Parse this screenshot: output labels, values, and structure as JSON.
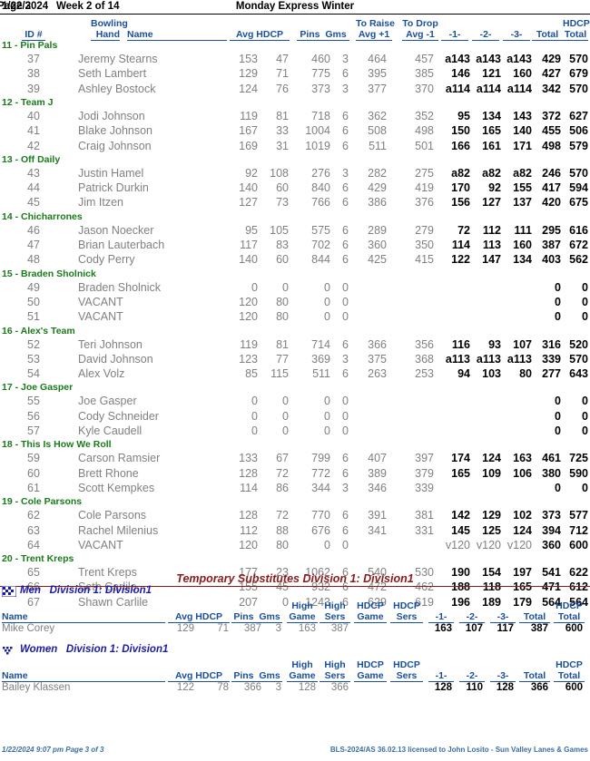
{
  "header": {
    "date": "1/22/2024",
    "week": "Week 2 of 14",
    "league": "Monday Express Winter",
    "page": "Page 3"
  },
  "columns": {
    "id": "ID #",
    "bowling": "Bowling",
    "hand": "Hand",
    "name": "Name",
    "avg_hdcp": "Avg HDCP",
    "pins_gms": "Pins  Gms",
    "to_raise": "To Raise",
    "raise_avg": "Avg +1",
    "to_drop": "To Drop",
    "drop_avg": "Avg -1",
    "g1": "-1-",
    "g2": "-2-",
    "g3": "-3-",
    "total": "Total",
    "hdcp": "HDCP",
    "hdcp_total": "Total"
  },
  "teams": [
    {
      "label": "11 - Pin Pals",
      "bowlers": [
        {
          "id": "37",
          "name": "Jeremy Stearns",
          "avg": "153",
          "hdcp": "47",
          "pins": "460",
          "gms": "3",
          "raise": "464",
          "drop": "457",
          "g1": "a143",
          "g2": "a143",
          "g3": "a143",
          "total": "429",
          "hdcp_total": "570",
          "bold_games": true
        },
        {
          "id": "38",
          "name": "Seth Lambert",
          "avg": "129",
          "hdcp": "71",
          "pins": "775",
          "gms": "6",
          "raise": "395",
          "drop": "385",
          "g1": "146",
          "g2": "121",
          "g3": "160",
          "total": "427",
          "hdcp_total": "679",
          "bold_games": true
        },
        {
          "id": "39",
          "name": "Ashley Bostock",
          "avg": "124",
          "hdcp": "76",
          "pins": "373",
          "gms": "3",
          "raise": "377",
          "drop": "370",
          "g1": "a114",
          "g2": "a114",
          "g3": "a114",
          "total": "342",
          "hdcp_total": "570",
          "bold_games": true
        }
      ]
    },
    {
      "label": "12 - Team J",
      "bowlers": [
        {
          "id": "40",
          "name": "Jodi Johnson",
          "avg": "119",
          "hdcp": "81",
          "pins": "718",
          "gms": "6",
          "raise": "362",
          "drop": "352",
          "g1": "95",
          "g2": "134",
          "g3": "143",
          "total": "372",
          "hdcp_total": "627",
          "bold_games": true
        },
        {
          "id": "41",
          "name": "Blake Johnson",
          "avg": "167",
          "hdcp": "33",
          "pins": "1004",
          "gms": "6",
          "raise": "508",
          "drop": "498",
          "g1": "150",
          "g2": "165",
          "g3": "140",
          "total": "455",
          "hdcp_total": "506",
          "bold_games": true
        },
        {
          "id": "42",
          "name": "Craig Johnson",
          "avg": "169",
          "hdcp": "31",
          "pins": "1019",
          "gms": "6",
          "raise": "511",
          "drop": "501",
          "g1": "166",
          "g2": "161",
          "g3": "171",
          "total": "498",
          "hdcp_total": "579",
          "bold_games": true
        }
      ]
    },
    {
      "label": "13 - Off Daily",
      "bowlers": [
        {
          "id": "43",
          "name": "Justin Hamel",
          "avg": "92",
          "hdcp": "108",
          "pins": "276",
          "gms": "3",
          "raise": "282",
          "drop": "275",
          "g1": "a82",
          "g2": "a82",
          "g3": "a82",
          "total": "246",
          "hdcp_total": "570",
          "bold_games": true
        },
        {
          "id": "44",
          "name": "Patrick Durkin",
          "avg": "140",
          "hdcp": "60",
          "pins": "840",
          "gms": "6",
          "raise": "429",
          "drop": "419",
          "g1": "170",
          "g2": "92",
          "g3": "155",
          "total": "417",
          "hdcp_total": "594",
          "bold_games": true
        },
        {
          "id": "45",
          "name": "Jim Itzen",
          "avg": "127",
          "hdcp": "73",
          "pins": "766",
          "gms": "6",
          "raise": "386",
          "drop": "376",
          "g1": "156",
          "g2": "127",
          "g3": "137",
          "total": "420",
          "hdcp_total": "675",
          "bold_games": true
        }
      ]
    },
    {
      "label": "14 - Chicharrones",
      "bowlers": [
        {
          "id": "46",
          "name": "Jason Noecker",
          "avg": "95",
          "hdcp": "105",
          "pins": "575",
          "gms": "6",
          "raise": "289",
          "drop": "279",
          "g1": "72",
          "g2": "112",
          "g3": "111",
          "total": "295",
          "hdcp_total": "616",
          "bold_games": true
        },
        {
          "id": "47",
          "name": "Brian Lauterbach",
          "avg": "117",
          "hdcp": "83",
          "pins": "702",
          "gms": "6",
          "raise": "360",
          "drop": "350",
          "g1": "114",
          "g2": "113",
          "g3": "160",
          "total": "387",
          "hdcp_total": "672",
          "bold_games": true
        },
        {
          "id": "48",
          "name": "Cody Perry",
          "avg": "140",
          "hdcp": "60",
          "pins": "844",
          "gms": "6",
          "raise": "425",
          "drop": "415",
          "g1": "122",
          "g2": "147",
          "g3": "134",
          "total": "403",
          "hdcp_total": "562",
          "bold_games": true
        }
      ]
    },
    {
      "label": "15 - Braden Sholnick",
      "bowlers": [
        {
          "id": "49",
          "name": "Braden Sholnick",
          "avg": "0",
          "hdcp": "0",
          "pins": "0",
          "gms": "0",
          "raise": "",
          "drop": "",
          "g1": "",
          "g2": "",
          "g3": "",
          "total": "0",
          "hdcp_total": "0",
          "bold_games": false
        },
        {
          "id": "50",
          "name": "VACANT",
          "avg": "120",
          "hdcp": "80",
          "pins": "0",
          "gms": "0",
          "raise": "",
          "drop": "",
          "g1": "",
          "g2": "",
          "g3": "",
          "total": "0",
          "hdcp_total": "0",
          "bold_games": false
        },
        {
          "id": "51",
          "name": "VACANT",
          "avg": "120",
          "hdcp": "80",
          "pins": "0",
          "gms": "0",
          "raise": "",
          "drop": "",
          "g1": "",
          "g2": "",
          "g3": "",
          "total": "0",
          "hdcp_total": "0",
          "bold_games": false
        }
      ]
    },
    {
      "label": "16 - Alex's Team",
      "bowlers": [
        {
          "id": "52",
          "name": "Teri Johnson",
          "avg": "119",
          "hdcp": "81",
          "pins": "714",
          "gms": "6",
          "raise": "366",
          "drop": "356",
          "g1": "116",
          "g2": "93",
          "g3": "107",
          "total": "316",
          "hdcp_total": "520",
          "bold_games": true
        },
        {
          "id": "53",
          "name": "David Johnson",
          "avg": "123",
          "hdcp": "77",
          "pins": "369",
          "gms": "3",
          "raise": "375",
          "drop": "368",
          "g1": "a113",
          "g2": "a113",
          "g3": "a113",
          "total": "339",
          "hdcp_total": "570",
          "bold_games": true
        },
        {
          "id": "54",
          "name": "Alex Volz",
          "avg": "85",
          "hdcp": "115",
          "pins": "511",
          "gms": "6",
          "raise": "263",
          "drop": "253",
          "g1": "94",
          "g2": "103",
          "g3": "80",
          "total": "277",
          "hdcp_total": "643",
          "bold_games": true
        }
      ]
    },
    {
      "label": "17 - Joe Gasper",
      "bowlers": [
        {
          "id": "55",
          "name": "Joe Gasper",
          "avg": "0",
          "hdcp": "0",
          "pins": "0",
          "gms": "0",
          "raise": "",
          "drop": "",
          "g1": "",
          "g2": "",
          "g3": "",
          "total": "0",
          "hdcp_total": "0",
          "bold_games": false
        },
        {
          "id": "56",
          "name": "Cody Schneider",
          "avg": "0",
          "hdcp": "0",
          "pins": "0",
          "gms": "0",
          "raise": "",
          "drop": "",
          "g1": "",
          "g2": "",
          "g3": "",
          "total": "0",
          "hdcp_total": "0",
          "bold_games": false
        },
        {
          "id": "57",
          "name": "Kyle Caudell",
          "avg": "0",
          "hdcp": "0",
          "pins": "0",
          "gms": "0",
          "raise": "",
          "drop": "",
          "g1": "",
          "g2": "",
          "g3": "",
          "total": "0",
          "hdcp_total": "0",
          "bold_games": false
        }
      ]
    },
    {
      "label": "18 - This Is How We Roll",
      "bowlers": [
        {
          "id": "59",
          "name": "Carson Ramsier",
          "avg": "133",
          "hdcp": "67",
          "pins": "799",
          "gms": "6",
          "raise": "407",
          "drop": "397",
          "g1": "174",
          "g2": "124",
          "g3": "163",
          "total": "461",
          "hdcp_total": "725",
          "bold_games": true
        },
        {
          "id": "60",
          "name": "Brett Rhone",
          "avg": "128",
          "hdcp": "72",
          "pins": "772",
          "gms": "6",
          "raise": "389",
          "drop": "379",
          "g1": "165",
          "g2": "109",
          "g3": "106",
          "total": "380",
          "hdcp_total": "590",
          "bold_games": true
        },
        {
          "id": "61",
          "name": "Scott Kempkes",
          "avg": "114",
          "hdcp": "86",
          "pins": "344",
          "gms": "3",
          "raise": "346",
          "drop": "339",
          "g1": "",
          "g2": "",
          "g3": "",
          "total": "0",
          "hdcp_total": "0",
          "bold_games": false
        }
      ]
    },
    {
      "label": "19 - Cole Parsons",
      "bowlers": [
        {
          "id": "62",
          "name": "Cole Parsons",
          "avg": "128",
          "hdcp": "72",
          "pins": "770",
          "gms": "6",
          "raise": "391",
          "drop": "381",
          "g1": "142",
          "g2": "129",
          "g3": "102",
          "total": "373",
          "hdcp_total": "577",
          "bold_games": true
        },
        {
          "id": "63",
          "name": "Rachel Milenius",
          "avg": "112",
          "hdcp": "88",
          "pins": "676",
          "gms": "6",
          "raise": "341",
          "drop": "331",
          "g1": "145",
          "g2": "125",
          "g3": "124",
          "total": "394",
          "hdcp_total": "712",
          "bold_games": true
        },
        {
          "id": "64",
          "name": "VACANT",
          "avg": "120",
          "hdcp": "80",
          "pins": "0",
          "gms": "0",
          "raise": "",
          "drop": "",
          "g1": "v120",
          "g2": "v120",
          "g3": "v120",
          "total": "360",
          "hdcp_total": "600",
          "bold_games": false
        }
      ]
    },
    {
      "label": "20 - Trent Kreps",
      "bowlers": [
        {
          "id": "65",
          "name": "Trent Kreps",
          "avg": "177",
          "hdcp": "23",
          "pins": "1062",
          "gms": "6",
          "raise": "540",
          "drop": "530",
          "g1": "190",
          "g2": "154",
          "g3": "197",
          "total": "541",
          "hdcp_total": "622",
          "bold_games": true
        },
        {
          "id": "66",
          "name": "Seth Carlile",
          "avg": "155",
          "hdcp": "45",
          "pins": "932",
          "gms": "6",
          "raise": "472",
          "drop": "462",
          "g1": "188",
          "g2": "118",
          "g3": "165",
          "total": "471",
          "hdcp_total": "612",
          "bold_games": true
        },
        {
          "id": "67",
          "name": "Shawn Carlile",
          "avg": "207",
          "hdcp": "0",
          "pins": "1243",
          "gms": "6",
          "raise": "629",
          "drop": "619",
          "g1": "196",
          "g2": "189",
          "g3": "179",
          "total": "564",
          "hdcp_total": "564",
          "bold_games": true
        }
      ]
    }
  ],
  "substitutes": {
    "title": "Temporary Substitutes   Division 1: Division1",
    "columns": {
      "name": "Name",
      "avg_hdcp": "Avg HDCP",
      "pins_gms": "Pins  Gms",
      "high": "High",
      "high_game": "Game",
      "high_sers": "Sers",
      "hdcp": "HDCP",
      "hdcp_game": "Game",
      "hdcp_sers": "Sers",
      "g1": "-1-",
      "g2": "-2-",
      "g3": "-3-",
      "total": "Total",
      "hdcp_total_top": "HDCP",
      "hdcp_total": "Total"
    },
    "groups": [
      {
        "icon": "men-icon",
        "label": "Men   Division 1: Division1",
        "rows": [
          {
            "name": "Mike Corey",
            "avg": "129",
            "hdcp": "71",
            "pins": "387",
            "gms": "3",
            "high_game": "163",
            "high_sers": "387",
            "hdcp_game": "",
            "hdcp_sers": "",
            "g1": "163",
            "g2": "107",
            "g3": "117",
            "total": "387",
            "hdcp_total": "600"
          }
        ]
      },
      {
        "icon": "women-icon",
        "label": "Women   Division 1: Division1",
        "rows": [
          {
            "name": "Bailey Klassen",
            "avg": "122",
            "hdcp": "78",
            "pins": "366",
            "gms": "3",
            "high_game": "128",
            "high_sers": "366",
            "hdcp_game": "",
            "hdcp_sers": "",
            "g1": "128",
            "g2": "110",
            "g3": "128",
            "total": "366",
            "hdcp_total": "600"
          }
        ]
      }
    ]
  },
  "footer": {
    "left": "1/22/2024  9:07 pm  Page 3 of 3",
    "right": "BLS-2024/AS 36.02.13 licensed to John Losito - Sun Valley Lanes & Games"
  }
}
